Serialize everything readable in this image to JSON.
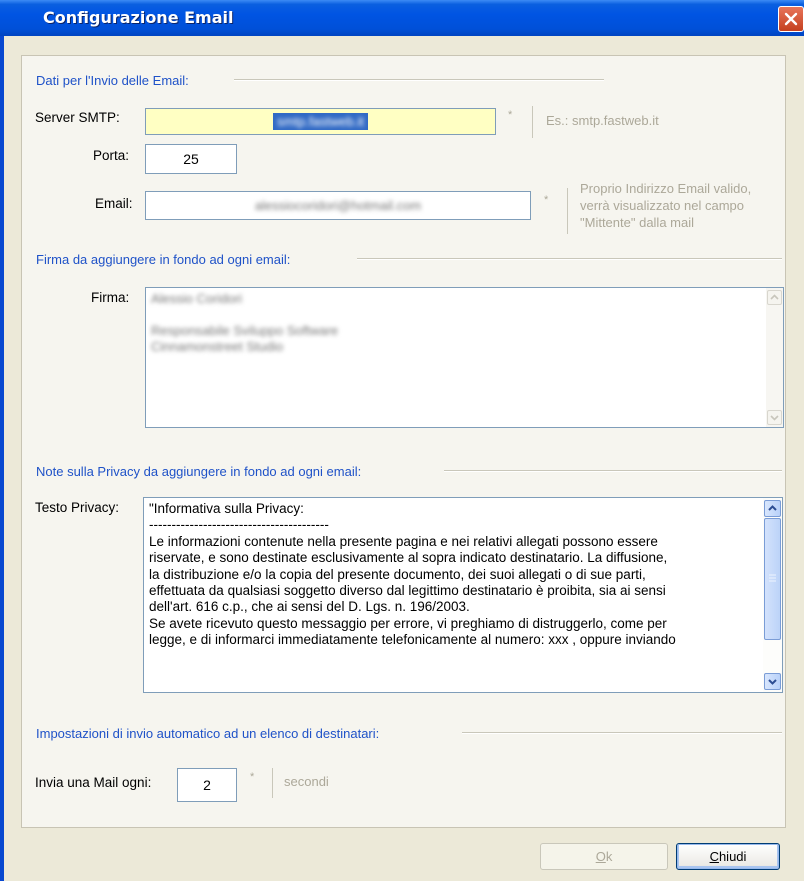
{
  "window": {
    "title": "Configurazione Email"
  },
  "invio": {
    "section_title": "Dati per l'Invio delle Email:",
    "server_label": "Server SMTP:",
    "server_value": "smtp.fastweb.it",
    "server_required": "*",
    "server_hint": "Es.: smtp.fastweb.it",
    "porta_label": "Porta:",
    "porta_value": "25",
    "email_label": "Email:",
    "email_value": "alessiocoridori@hotmail.com",
    "email_required": "*",
    "email_hint_lines": [
      "Proprio Indirizzo Email valido,",
      "verrà visualizzato nel campo",
      "\"Mittente\" dalla mail"
    ]
  },
  "firma": {
    "section_title": "Firma da aggiungere in fondo ad ogni email:",
    "label": "Firma:",
    "lines": [
      "Alessio Coridori",
      "",
      "Responsabile Sviluppo Software",
      "Cinnamonstreet Studio"
    ]
  },
  "privacy": {
    "section_title": "Note sulla Privacy da aggiungere in fondo ad ogni email:",
    "label": "Testo Privacy:",
    "lines": [
      "\"Informativa sulla Privacy:",
      "----------------------------------------",
      "Le informazioni contenute nella presente pagina e nei relativi allegati possono essere",
      "riservate, e sono destinate esclusivamente al sopra indicato destinatario. La diffusione,",
      "la distribuzione e/o la copia del presente documento, dei suoi allegati o di sue parti,",
      "effettuata da qualsiasi soggetto diverso dal legittimo destinatario è proibita, sia ai sensi",
      "dell'art. 616 c.p., che ai sensi del D. Lgs. n. 196/2003.",
      "Se avete ricevuto questo messaggio per errore, vi preghiamo di distruggerlo, come per",
      "legge, e di informarci immediatamente telefonicamente al numero: xxx , oppure inviando"
    ]
  },
  "auto": {
    "section_title": "Impostazioni di invio automatico ad un elenco di destinatari:",
    "label": "Invia una Mail ogni:",
    "value": "2",
    "required": "*",
    "unit": "secondi"
  },
  "buttons": {
    "ok_prefix": "O",
    "ok_rest": "k",
    "close_prefix": "C",
    "close_rest": "hiudi"
  },
  "colors": {
    "section_title": "#1F52C8",
    "titlebar": "#0054E3",
    "server_highlight": "#FFFFC3"
  }
}
